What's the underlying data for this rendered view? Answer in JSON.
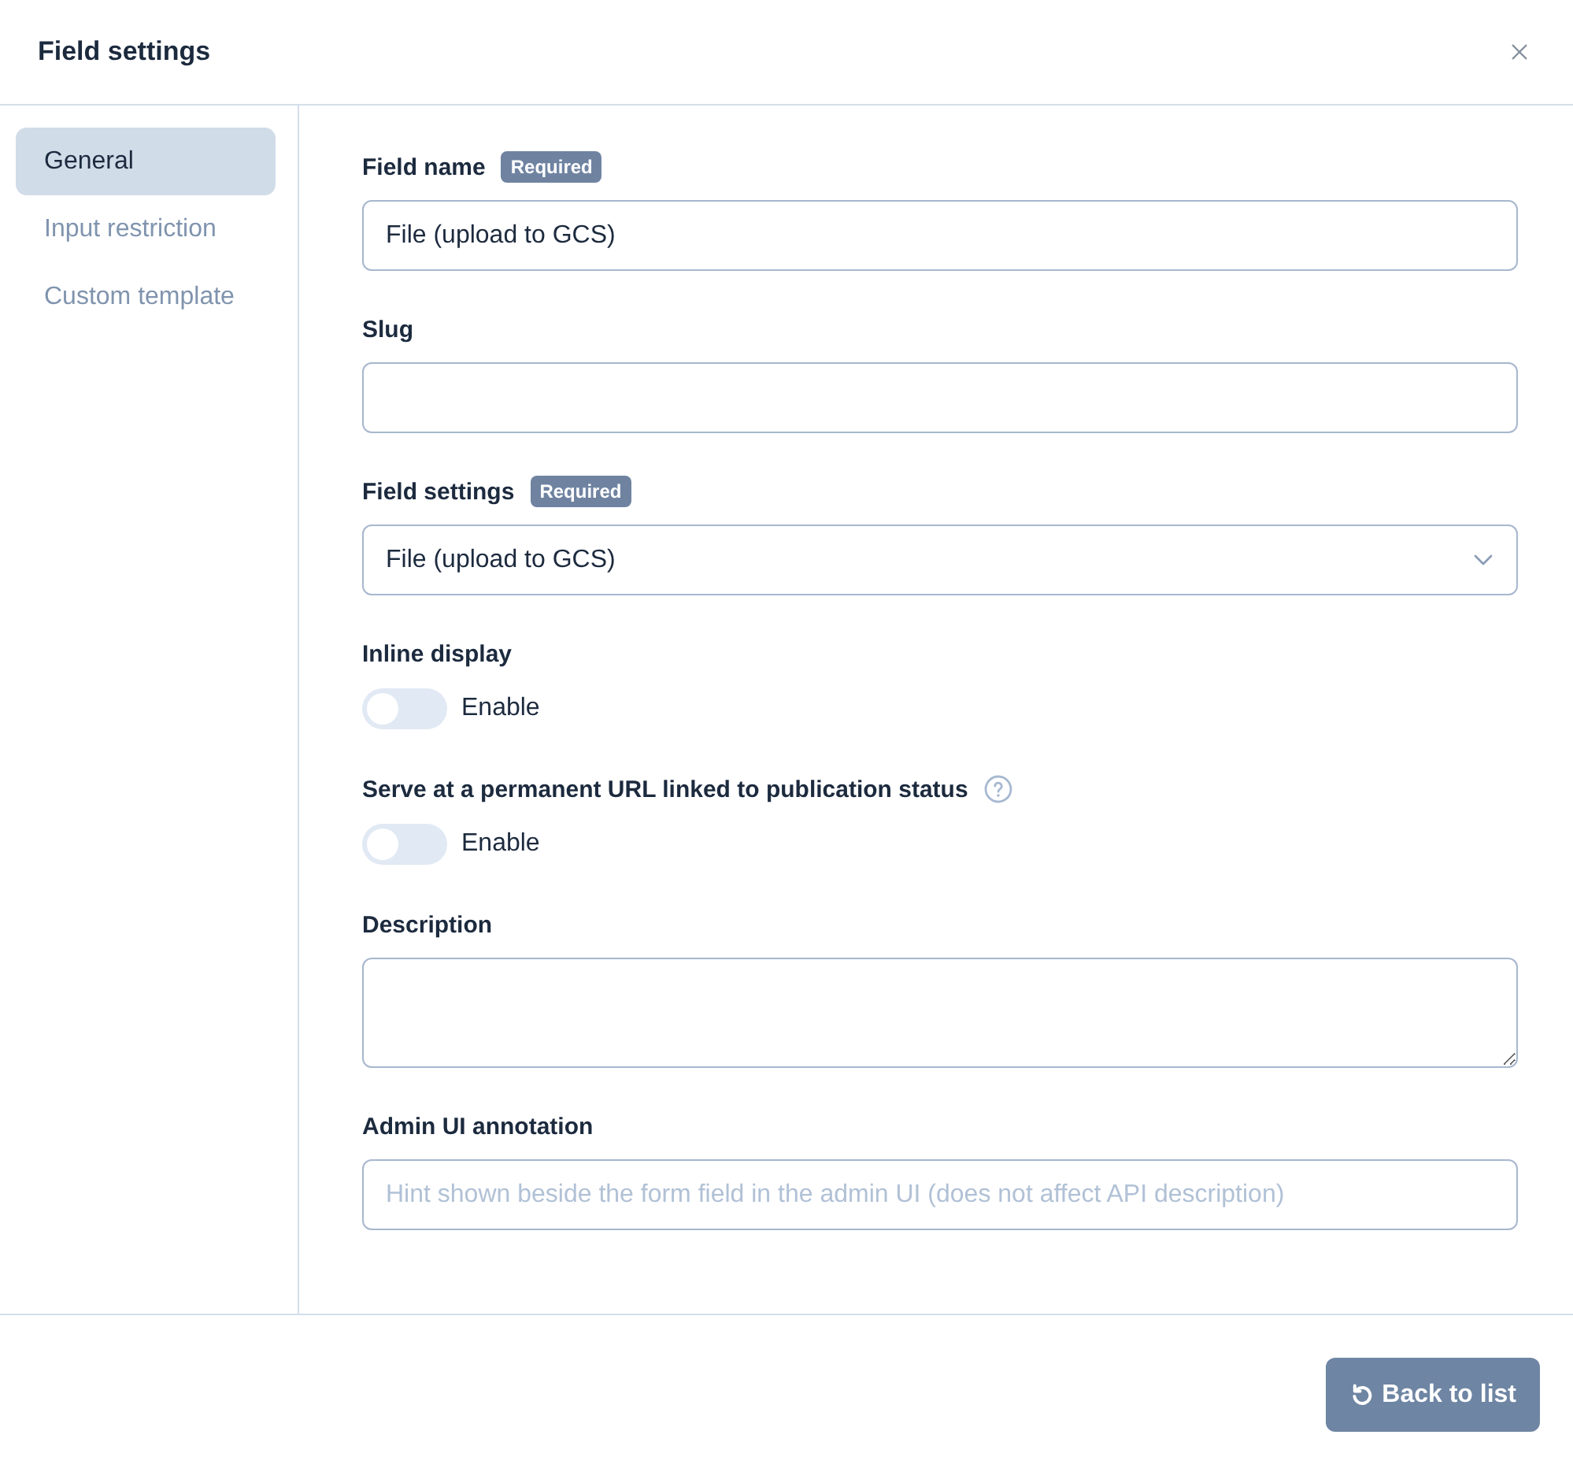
{
  "dialog": {
    "title": "Field settings"
  },
  "sidebar": {
    "items": [
      {
        "label": "General",
        "selected": true
      },
      {
        "label": "Input restriction",
        "selected": false
      },
      {
        "label": "Custom template",
        "selected": false
      }
    ]
  },
  "fields": [
    {
      "kind": "text",
      "label": "Field name",
      "badge": "Required",
      "value": "File (upload to GCS)"
    },
    {
      "kind": "text",
      "label": "Slug"
    },
    {
      "kind": "select",
      "label": "Field settings",
      "badge": "Required",
      "value": "File (upload to GCS)"
    },
    {
      "kind": "toggle",
      "label": "Inline display",
      "on": false,
      "toggle_label": "Enable"
    },
    {
      "kind": "toggle",
      "label": "Serve at a permanent URL linked to publication status",
      "help": true,
      "on": false,
      "toggle_label": "Enable"
    },
    {
      "kind": "textarea",
      "label": "Description"
    },
    {
      "kind": "text",
      "label": "Admin UI annotation",
      "placeholder": "Hint shown beside the form field in the admin UI (does not affect API description)"
    }
  ],
  "footer": {
    "button": "Back to list"
  }
}
